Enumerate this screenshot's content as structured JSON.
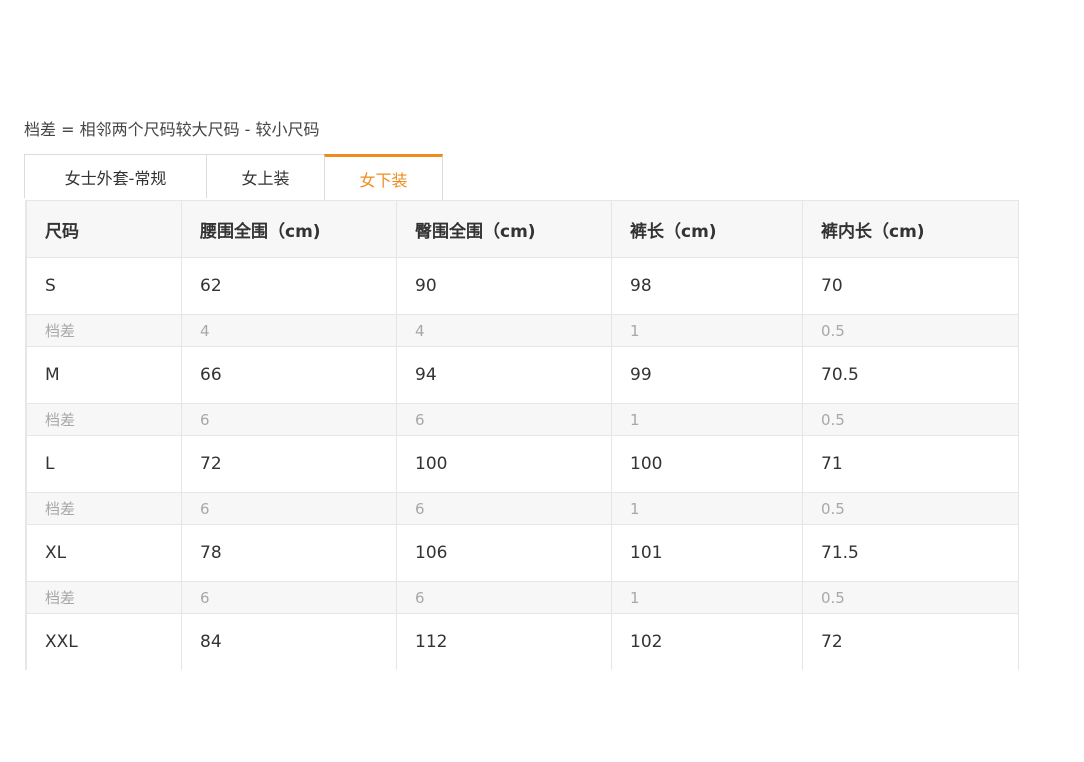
{
  "note": "档差 = 相邻两个尺码较大尺码 - 较小尺码",
  "tabs": [
    {
      "label": "女士外套-常规",
      "active": false
    },
    {
      "label": "女上装",
      "active": false
    },
    {
      "label": "女下装",
      "active": true
    }
  ],
  "accent_color": "#f08c1e",
  "table": {
    "headers": [
      "尺码",
      "腰围全围（cm)",
      "臀围全围（cm)",
      "裤长（cm)",
      "裤内长（cm)"
    ],
    "rows": [
      {
        "type": "size",
        "cells": [
          "S",
          "62",
          "90",
          "98",
          "70"
        ]
      },
      {
        "type": "diff",
        "cells": [
          "档差",
          "4",
          "4",
          "1",
          "0.5"
        ]
      },
      {
        "type": "size",
        "cells": [
          "M",
          "66",
          "94",
          "99",
          "70.5"
        ]
      },
      {
        "type": "diff",
        "cells": [
          "档差",
          "6",
          "6",
          "1",
          "0.5"
        ]
      },
      {
        "type": "size",
        "cells": [
          "L",
          "72",
          "100",
          "100",
          "71"
        ]
      },
      {
        "type": "diff",
        "cells": [
          "档差",
          "6",
          "6",
          "1",
          "0.5"
        ]
      },
      {
        "type": "size",
        "cells": [
          "XL",
          "78",
          "106",
          "101",
          "71.5"
        ]
      },
      {
        "type": "diff",
        "cells": [
          "档差",
          "6",
          "6",
          "1",
          "0.5"
        ]
      },
      {
        "type": "size",
        "cells": [
          "XXL",
          "84",
          "112",
          "102",
          "72"
        ]
      }
    ]
  }
}
